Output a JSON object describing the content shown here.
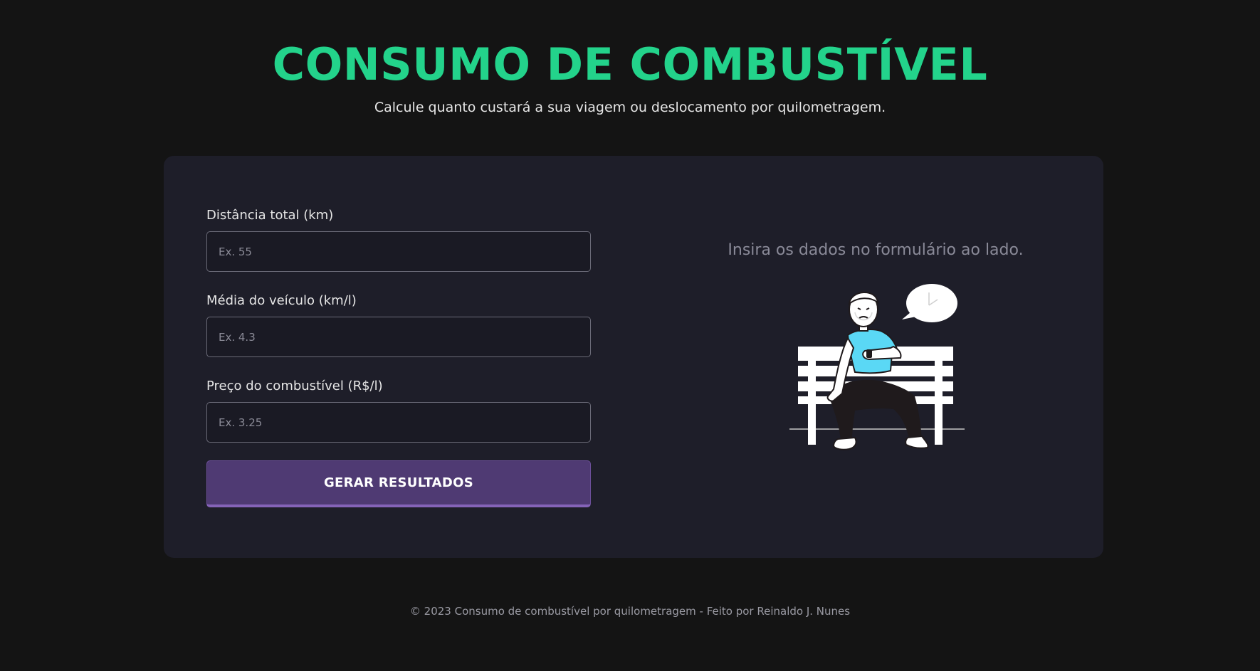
{
  "header": {
    "title": "CONSUMO DE COMBUSTÍVEL",
    "subtitle": "Calcule quanto custará a sua viagem ou deslocamento por quilometragem."
  },
  "form": {
    "distance": {
      "label": "Distância total (km)",
      "placeholder": "Ex. 55",
      "value": ""
    },
    "average": {
      "label": "Média do veículo (km/l)",
      "placeholder": "Ex. 4.3",
      "value": ""
    },
    "price": {
      "label": "Preço do combustível (R$/l)",
      "placeholder": "Ex. 3.25",
      "value": ""
    },
    "submit_label": "GERAR RESULTADOS"
  },
  "result": {
    "message": "Insira os dados no formulário ao lado.",
    "illustration": "man-waiting-on-bench-illustration"
  },
  "footer": {
    "text": "© 2023 Consumo de combustível por quilometragem - Feito por Reinaldo J. Nunes"
  },
  "colors": {
    "background": "#141414",
    "card": "#1e1e29",
    "accent_green": "#23d38b",
    "button_purple": "#4f3a73",
    "shirt_blue": "#5ad8f5"
  }
}
